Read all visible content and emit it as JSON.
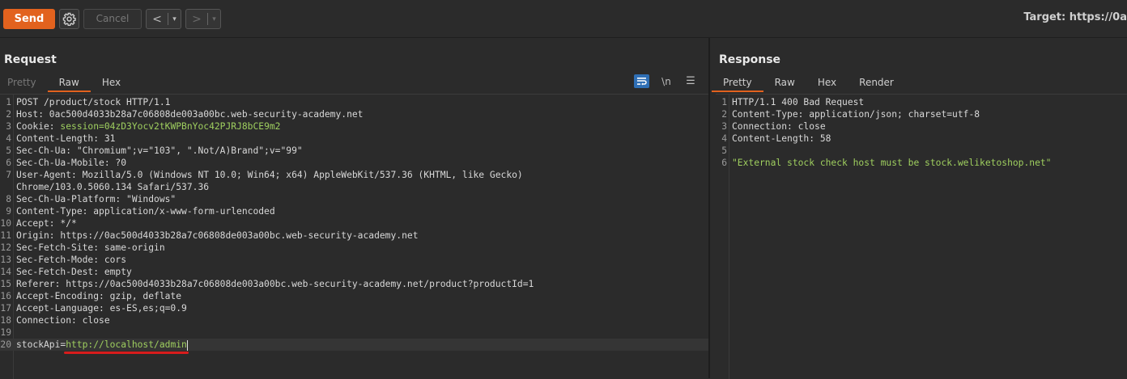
{
  "toolbar": {
    "send_label": "Send",
    "cancel_label": "Cancel",
    "back_arrow": "<",
    "forward_arrow": ">",
    "dropdown_glyph": "▾",
    "target_text": "Target: https://0a"
  },
  "request": {
    "title": "Request",
    "tabs": [
      "Pretty",
      "Raw",
      "Hex"
    ],
    "active_tab": "Raw",
    "newline_toggle": "\\n",
    "menu_glyph": "☰",
    "lines": [
      {
        "n": "1",
        "text": "POST /product/stock HTTP/1.1"
      },
      {
        "n": "2",
        "text": "Host: 0ac500d4033b28a7c06808de003a00bc.web-security-academy.net"
      },
      {
        "n": "3",
        "key": "Cookie: ",
        "attr": "session=",
        "val": "04zD3Yocv2tKWPBnYoc42PJRJ8bCE9m2"
      },
      {
        "n": "4",
        "text": "Content-Length: 31"
      },
      {
        "n": "5",
        "text": "Sec-Ch-Ua: \"Chromium\";v=\"103\", \".Not/A)Brand\";v=\"99\""
      },
      {
        "n": "6",
        "text": "Sec-Ch-Ua-Mobile: ?0"
      },
      {
        "n": "7",
        "text": "User-Agent: Mozilla/5.0 (Windows NT 10.0; Win64; x64) AppleWebKit/537.36 (KHTML, like Gecko)"
      },
      {
        "n": "",
        "text": "Chrome/103.0.5060.134 Safari/537.36"
      },
      {
        "n": "8",
        "text": "Sec-Ch-Ua-Platform: \"Windows\""
      },
      {
        "n": "9",
        "text": "Content-Type: application/x-www-form-urlencoded"
      },
      {
        "n": "10",
        "text": "Accept: */*"
      },
      {
        "n": "11",
        "text": "Origin: https://0ac500d4033b28a7c06808de003a00bc.web-security-academy.net"
      },
      {
        "n": "12",
        "text": "Sec-Fetch-Site: same-origin"
      },
      {
        "n": "13",
        "text": "Sec-Fetch-Mode: cors"
      },
      {
        "n": "14",
        "text": "Sec-Fetch-Dest: empty"
      },
      {
        "n": "15",
        "text": "Referer: https://0ac500d4033b28a7c06808de003a00bc.web-security-academy.net/product?productId=1"
      },
      {
        "n": "16",
        "text": "Accept-Encoding: gzip, deflate"
      },
      {
        "n": "17",
        "text": "Accept-Language: es-ES,es;q=0.9"
      },
      {
        "n": "18",
        "text": "Connection: close"
      },
      {
        "n": "19",
        "text": ""
      },
      {
        "n": "20",
        "key": "stockApi=",
        "val": "http://localhost/admin",
        "current": true
      }
    ]
  },
  "response": {
    "title": "Response",
    "tabs": [
      "Pretty",
      "Raw",
      "Hex",
      "Render"
    ],
    "active_tab": "Pretty",
    "lines": [
      {
        "n": "1",
        "text": "HTTP/1.1 400 Bad Request"
      },
      {
        "n": "2",
        "text": "Content-Type: application/json; charset=utf-8"
      },
      {
        "n": "3",
        "text": "Connection: close"
      },
      {
        "n": "4",
        "text": "Content-Length: 58"
      },
      {
        "n": "5",
        "text": ""
      },
      {
        "n": "6",
        "val": "\"External stock check host must be stock.weliketoshop.net\""
      }
    ]
  },
  "colors": {
    "accent": "#e2621e",
    "string_value": "#9fcf5f",
    "highlight_underline": "#d81c1c"
  }
}
